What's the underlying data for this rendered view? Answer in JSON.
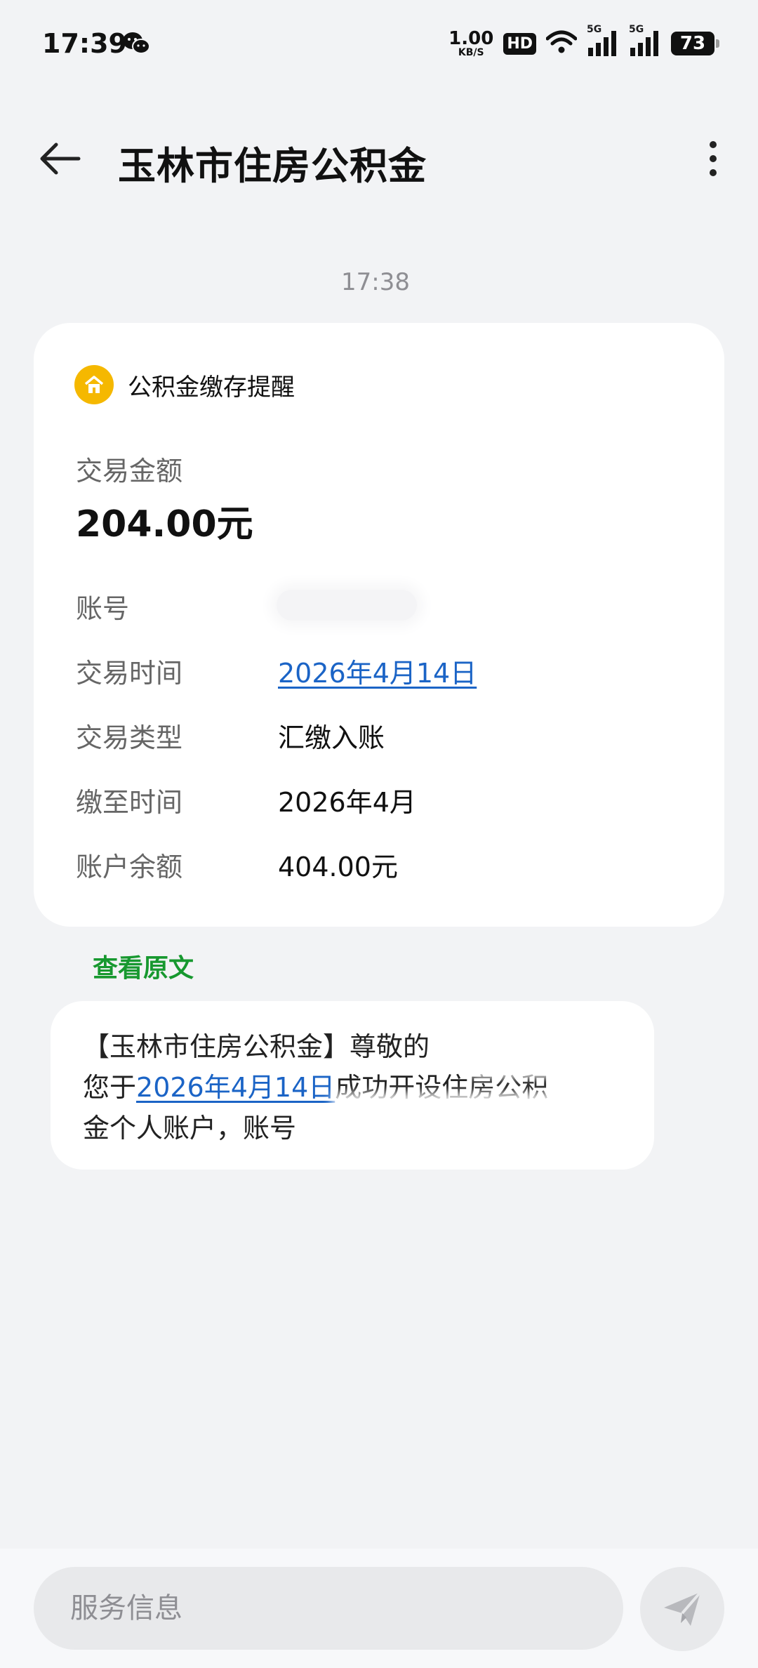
{
  "status_bar": {
    "time": "17:39",
    "net_speed_value": "1.00",
    "net_speed_unit": "KB/S",
    "hd_label": "HD",
    "network_1": "5G",
    "network_2": "5G",
    "battery": "73",
    "icons": [
      "wechat-icon",
      "wifi-icon",
      "signal-icon",
      "battery-icon"
    ]
  },
  "header": {
    "title": "玉林市住房公积金"
  },
  "message": {
    "time": "17:38",
    "card": {
      "title": "公积金缴存提醒",
      "amount_label": "交易金额",
      "amount_value": "204.00元",
      "fields": [
        {
          "label": "账号",
          "value": ""
        },
        {
          "label": "交易时间",
          "value": "2026年4月14日"
        },
        {
          "label": "交易类型",
          "value": "汇缴入账"
        },
        {
          "label": "缴至时间",
          "value": "2026年4月"
        },
        {
          "label": "账户余额",
          "value": "404.00元"
        }
      ]
    },
    "view_original": "查看原文",
    "raw_sms": {
      "line1": "【玉林市住房公积金】尊敬的",
      "line2_prefix": "您于",
      "line2_link": "2026年4月14日",
      "line2_suffix": "成功开设住房公积",
      "line3": "金个人账户，账号"
    }
  },
  "bottom_bar": {
    "input_placeholder": "服务信息"
  },
  "colors": {
    "background": "#f2f3f5",
    "link": "#1b64c6",
    "view_original": "#17982f",
    "badge_icon": "#f5b800"
  }
}
